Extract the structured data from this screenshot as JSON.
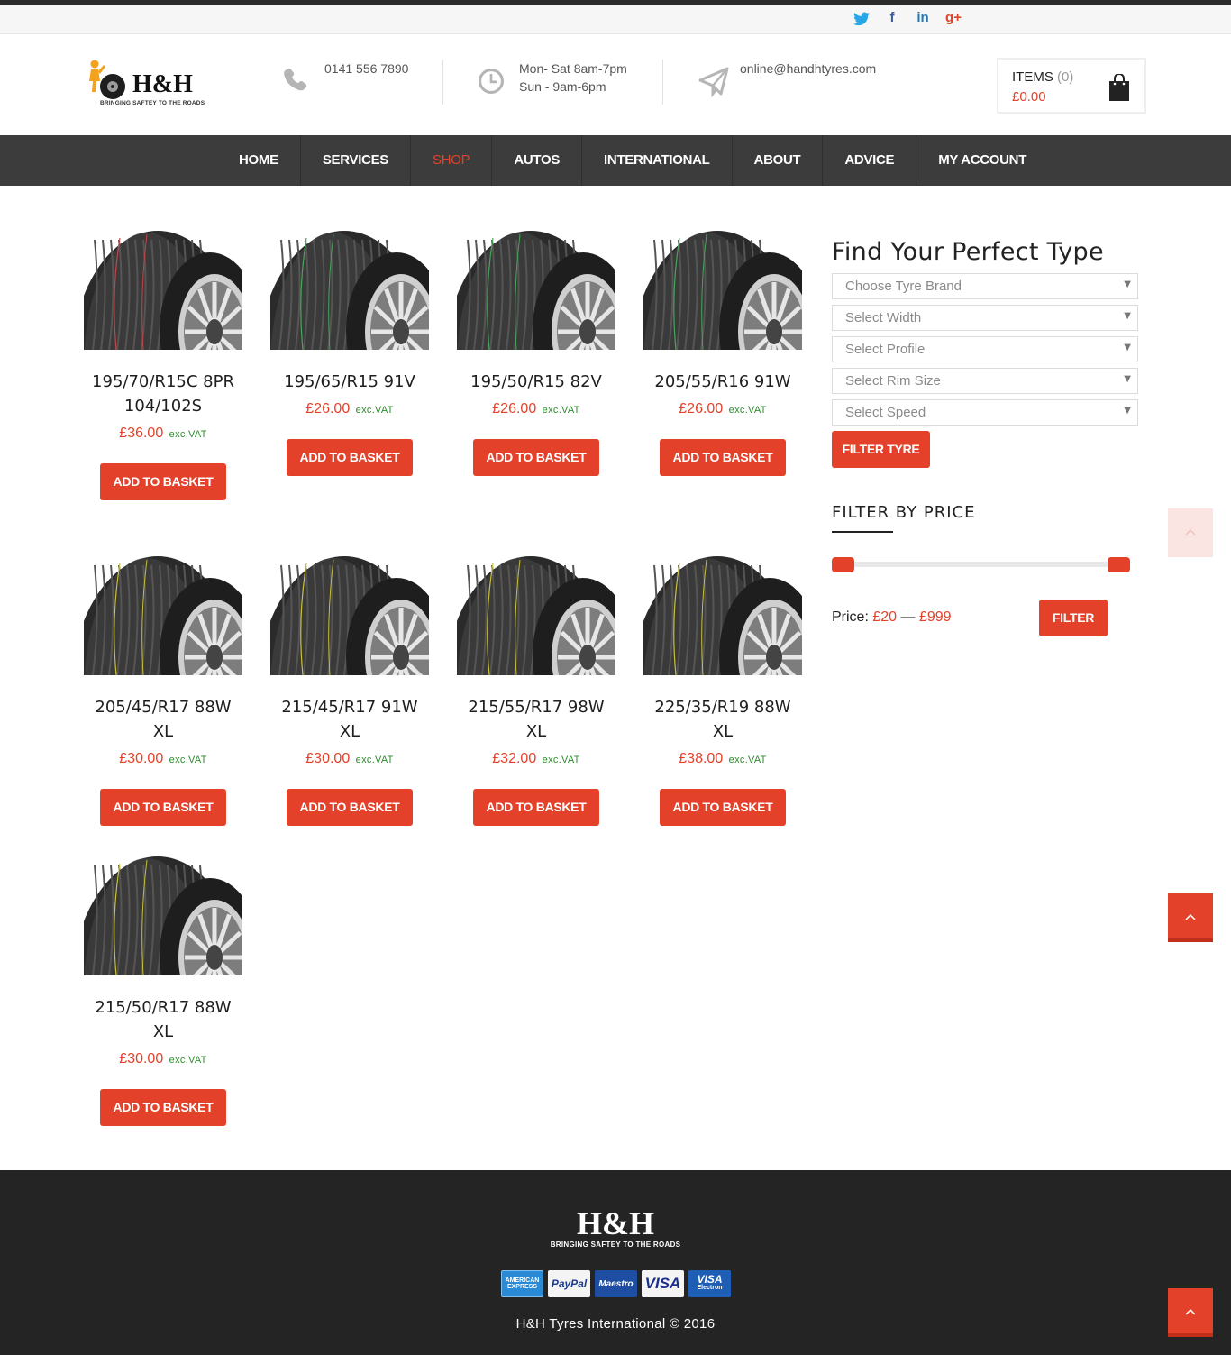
{
  "social": {
    "twitter": "twitter-icon",
    "facebook": "facebook-icon",
    "linkedin": "linkedin-icon",
    "googleplus": "google-plus-icon",
    "twitter_glyph": "🐦",
    "facebook_glyph": "f",
    "linkedin_glyph": "in",
    "googleplus_glyph": "g+"
  },
  "brand": {
    "name": "H&H",
    "tagline": "BRINGING SAFTEY TO THE ROADS",
    "accent": "#e4412a"
  },
  "contact": {
    "phone": "0141 556 7890",
    "hours_line1": "Mon- Sat 8am-7pm",
    "hours_line2": "Sun - 9am-6pm",
    "email": "online@handhtyres.com"
  },
  "cart": {
    "items_label": "ITEMS",
    "items_count": "(0)",
    "total": "£0.00"
  },
  "nav": {
    "items": [
      {
        "label": "HOME"
      },
      {
        "label": "SERVICES"
      },
      {
        "label": "SHOP"
      },
      {
        "label": "AUTOS"
      },
      {
        "label": "INTERNATIONAL"
      },
      {
        "label": "ABOUT"
      },
      {
        "label": "ADVICE"
      },
      {
        "label": "MY ACCOUNT"
      }
    ],
    "active": "SHOP"
  },
  "products": [
    {
      "title": "195/70/R15C 8PR 104/102S",
      "price": "£36.00",
      "vat": "exc.VAT",
      "button": "ADD TO BASKET"
    },
    {
      "title": "195/65/R15 91V",
      "price": "£26.00",
      "vat": "exc.VAT",
      "button": "ADD TO BASKET"
    },
    {
      "title": "195/50/R15 82V",
      "price": "£26.00",
      "vat": "exc.VAT",
      "button": "ADD TO BASKET"
    },
    {
      "title": "205/55/R16 91W",
      "price": "£26.00",
      "vat": "exc.VAT",
      "button": "ADD TO BASKET"
    },
    {
      "title": "205/45/R17 88W XL",
      "price": "£30.00",
      "vat": "exc.VAT",
      "button": "ADD TO BASKET"
    },
    {
      "title": "215/45/R17 91W XL",
      "price": "£30.00",
      "vat": "exc.VAT",
      "button": "ADD TO BASKET"
    },
    {
      "title": "215/55/R17 98W XL",
      "price": "£32.00",
      "vat": "exc.VAT",
      "button": "ADD TO BASKET"
    },
    {
      "title": "225/35/R19 88W XL",
      "price": "£38.00",
      "vat": "exc.VAT",
      "button": "ADD TO BASKET"
    },
    {
      "title": "215/50/R17 88W XL",
      "price": "£30.00",
      "vat": "exc.VAT",
      "button": "ADD TO BASKET"
    }
  ],
  "sidebar": {
    "title": "Find Your Perfect Type",
    "selects": [
      {
        "placeholder": "Choose Tyre Brand"
      },
      {
        "placeholder": "Select Width"
      },
      {
        "placeholder": "Select Profile"
      },
      {
        "placeholder": "Select Rim Size"
      },
      {
        "placeholder": "Select Speed"
      }
    ],
    "filter_button": "FILTER TYRE",
    "price_filter": {
      "title": "FILTER BY PRICE",
      "label": "Price:",
      "min": "£20",
      "separator": "—",
      "max": "£999",
      "button": "FILTER"
    }
  },
  "float_buttons": {
    "icon": "chevron-up-icon",
    "glyph": "^"
  },
  "footer": {
    "logo_name": "H&H",
    "logo_tagline": "BRINGING SAFTEY TO THE ROADS",
    "cards": [
      {
        "name": "amex-icon",
        "label": "AMERICAN EXPRESS"
      },
      {
        "name": "paypal-icon",
        "label": "PayPal"
      },
      {
        "name": "maestro-icon",
        "label": "Maestro"
      },
      {
        "name": "visa-icon",
        "label": "VISA"
      },
      {
        "name": "visa-electron-icon",
        "label": "VISA",
        "sub": "Electron"
      }
    ],
    "copyright": "H&H Tyres International © 2016"
  }
}
